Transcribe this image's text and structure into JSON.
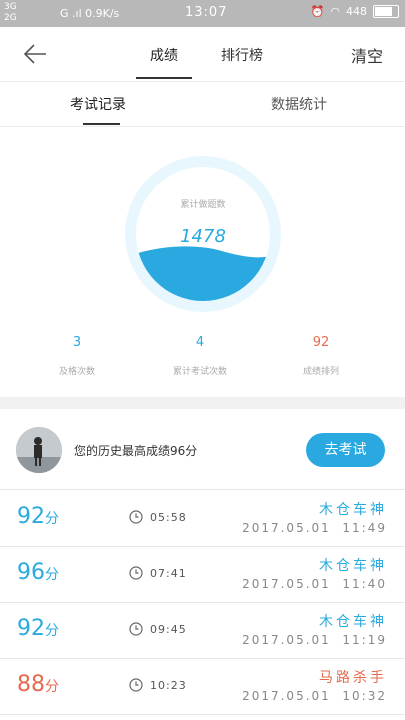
{
  "status": {
    "signal_top": "3G",
    "signal_bottom": "2G",
    "network": "G .ıl 0.9K/s",
    "time": "13:07",
    "battery_text": "448"
  },
  "topbar": {
    "tab_score": "成绩",
    "tab_rank": "排行榜",
    "clear": "清空"
  },
  "subtabs": {
    "records": "考试记录",
    "stats": "数据统计"
  },
  "gauge": {
    "label": "累计做题数",
    "value": "1478",
    "fill_fraction": 0.36,
    "color": "#2aa9e0"
  },
  "stats": [
    {
      "value": "3",
      "label": "及格次数",
      "color": "#2aa9e0"
    },
    {
      "value": "4",
      "label": "累计考试次数",
      "color": "#2aa9e0"
    },
    {
      "value": "92",
      "label": "成绩排列",
      "color": "#e66a4e"
    }
  ],
  "best": {
    "text": "您的历史最高成绩96分",
    "button": "去考试"
  },
  "records": [
    {
      "score": "92",
      "unit": "分",
      "duration": "05:58",
      "title": "木仓车神",
      "date": "2017.05.01  11:49",
      "color": "#2aa9e0"
    },
    {
      "score": "96",
      "unit": "分",
      "duration": "07:41",
      "title": "木仓车神",
      "date": "2017.05.01  11:40",
      "color": "#2aa9e0"
    },
    {
      "score": "92",
      "unit": "分",
      "duration": "09:45",
      "title": "木仓车神",
      "date": "2017.05.01  11:19",
      "color": "#2aa9e0"
    },
    {
      "score": "88",
      "unit": "分",
      "duration": "10:23",
      "title": "马路杀手",
      "date": "2017.05.01  10:32",
      "color": "#e66a4e"
    }
  ]
}
